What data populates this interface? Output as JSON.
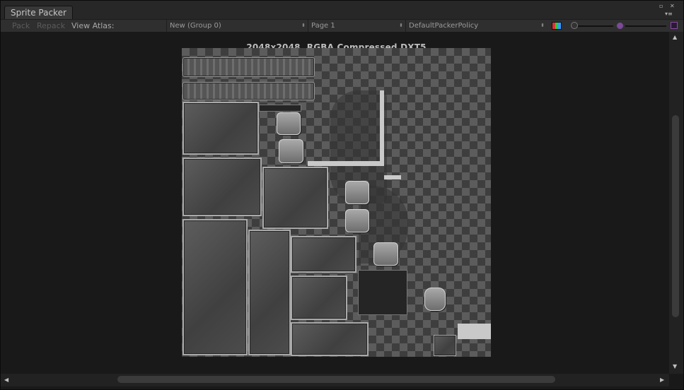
{
  "window": {
    "tab_title": "Sprite Packer"
  },
  "toolbar": {
    "pack_label": "Pack",
    "repack_label": "Repack",
    "view_atlas_label": "View Atlas:",
    "atlas_group_value": "New (Group 0)",
    "page_value": "Page 1",
    "policy_value": "DefaultPackerPolicy",
    "color_channel_icon": "rgb-channel-icon",
    "alpha_icon": "alpha-checker-icon"
  },
  "viewport": {
    "atlas_info": "2048x2048, RGBA Compressed DXT5"
  },
  "icons": {
    "maximize": "▫",
    "close": "✕",
    "menu": "▾≡",
    "dropdown_arrow": "⬍",
    "scroll_up": "▲",
    "scroll_down": "▼",
    "scroll_left": "◀",
    "scroll_right": "▶"
  },
  "colors": {
    "accent_purple": "#8a4ca8",
    "checker_light": "#5c5c5c",
    "checker_dark": "#3e3e3e"
  }
}
